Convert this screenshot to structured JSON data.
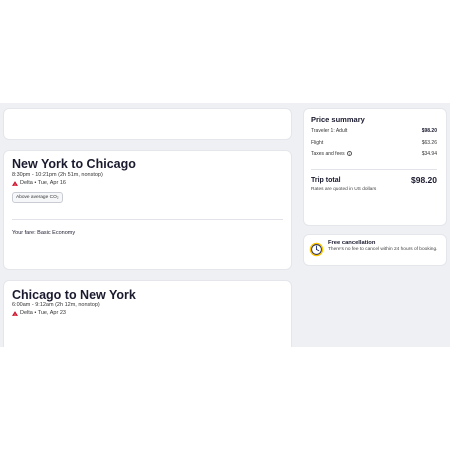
{
  "legs": [
    {
      "title": "New York to Chicago",
      "times": "8:30pm - 10:21pm (2h 51m, nonstop)",
      "airline_date": "Delta • Tue, Apr 16",
      "badge": "Above average CO₂",
      "fare": "Your fare: Basic Economy"
    },
    {
      "title": "Chicago to New York",
      "times": "6:00am - 9:12am (2h 12m, nonstop)",
      "airline_date": "Delta • Tue, Apr 23"
    }
  ],
  "price_summary": {
    "title": "Price summary",
    "rows": [
      {
        "label": "Traveler 1: Adult",
        "value": "$98.20"
      },
      {
        "label": "Flight",
        "value": "$63.26"
      },
      {
        "label": "Taxes and fees",
        "value": "$34.94"
      }
    ],
    "total_label": "Trip total",
    "total_value": "$98.20",
    "note": "Rates are quoted in US dollars"
  },
  "free_cancellation": {
    "title": "Free cancellation",
    "text": "There's no fee to cancel within 24 hours of booking."
  },
  "colors": {
    "page_background": "#eef0f4",
    "delta_red": "#c8102e",
    "clock_yellow": "#ffc400",
    "clock_navy": "#1b2a6b"
  },
  "icons": {
    "airline": "delta-logo-icon",
    "info": "info-icon",
    "cancellation": "clock-icon"
  }
}
